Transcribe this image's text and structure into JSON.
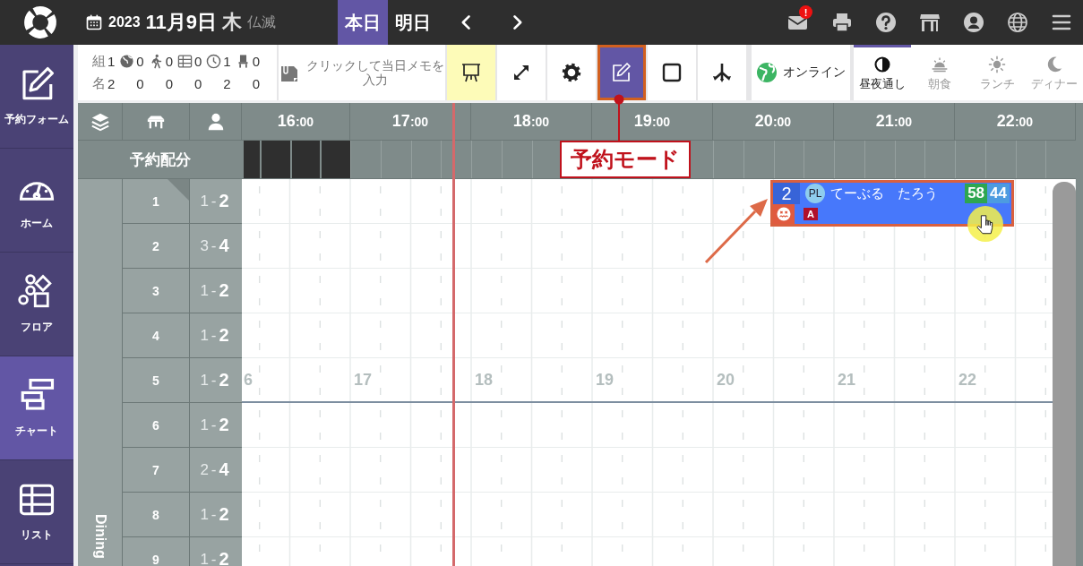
{
  "top_bar": {
    "date": {
      "year": "2023",
      "day": "11月9日",
      "weekday": "木",
      "rokuyo": "仏滅"
    },
    "day_tabs": [
      {
        "label": "本日",
        "selected": true
      },
      {
        "label": "明日",
        "selected": false
      }
    ],
    "mail_badge": "!"
  },
  "sidebar": {
    "items": [
      {
        "kind": "form",
        "label": "予約フォーム",
        "selected": false
      },
      {
        "kind": "home",
        "label": "ホーム",
        "selected": false
      },
      {
        "kind": "floor",
        "label": "フロア",
        "selected": false
      },
      {
        "kind": "chart",
        "label": "チャート",
        "selected": true
      },
      {
        "kind": "list",
        "label": "リスト",
        "selected": false
      }
    ]
  },
  "toolbar": {
    "stats": {
      "row_labels": [
        "組",
        "名"
      ],
      "columns": [
        {
          "kind": "total",
          "values": [
            "1",
            "2"
          ]
        },
        {
          "kind": "web",
          "values": [
            "0",
            "0"
          ]
        },
        {
          "kind": "walk_in",
          "values": [
            "0",
            "0"
          ]
        },
        {
          "kind": "list",
          "values": [
            "0",
            "0"
          ]
        },
        {
          "kind": "waiting",
          "values": [
            "1",
            "2"
          ]
        },
        {
          "kind": "seated",
          "values": [
            "0",
            "0"
          ]
        }
      ]
    },
    "memo": "クリックして当日メモを入力",
    "tools": [
      {
        "kind": "easel",
        "on": true,
        "highlighted": false
      },
      {
        "kind": "expand",
        "on": false,
        "highlighted": false
      },
      {
        "kind": "gear",
        "on": false,
        "highlighted": false
      },
      {
        "kind": "edit",
        "on": true,
        "highlighted": true
      },
      {
        "kind": "square",
        "on": false,
        "highlighted": false
      },
      {
        "kind": "fork",
        "on": false,
        "highlighted": false
      }
    ],
    "online": "オンライン",
    "meal_tabs": [
      {
        "kind": "all",
        "label": "昼夜通し",
        "selected": true
      },
      {
        "kind": "breakfast",
        "label": "朝食",
        "selected": false
      },
      {
        "kind": "lunch",
        "label": "ランチ",
        "selected": false
      },
      {
        "kind": "dinner",
        "label": "ディナー",
        "selected": false
      }
    ]
  },
  "chart": {
    "times": [
      {
        "label": "**16**:00",
        "blocked": true
      },
      {
        "label": "**17**:00",
        "blocked": false
      },
      {
        "label": "**18**:00",
        "blocked": false
      },
      {
        "label": "**19**:00",
        "blocked": false
      },
      {
        "label": "**20**:00",
        "blocked": false
      },
      {
        "label": "**21**:00",
        "blocked": false
      },
      {
        "label": "**22**:00",
        "blocked": false
      }
    ],
    "allocation_label": "予約配分",
    "area": "Dining",
    "hour_marks": [
      "6",
      "17",
      "18",
      "19",
      "20",
      "21",
      "22"
    ],
    "tables": [
      {
        "number": "1",
        "capacity": "1-**2**",
        "corner_mark": true,
        "hour_marks": false
      },
      {
        "number": "2",
        "capacity": "3-**4**",
        "corner_mark": false,
        "hour_marks": false
      },
      {
        "number": "3",
        "capacity": "1-**2**",
        "corner_mark": false,
        "hour_marks": false
      },
      {
        "number": "4",
        "capacity": "1-**2**",
        "corner_mark": false,
        "hour_marks": false
      },
      {
        "number": "5",
        "capacity": "1-**2**",
        "corner_mark": false,
        "hour_marks": true
      },
      {
        "number": "6",
        "capacity": "1-**2**",
        "corner_mark": false,
        "hour_marks": false
      },
      {
        "number": "7",
        "capacity": "2-**4**",
        "corner_mark": false,
        "hour_marks": false
      },
      {
        "number": "8",
        "capacity": "1-**2**",
        "corner_mark": false,
        "hour_marks": false
      },
      {
        "number": "9",
        "capacity": "1-**2**",
        "corner_mark": false,
        "hour_marks": false
      }
    ],
    "reservation": {
      "party": "2",
      "staff": "PL",
      "name": "てーぶる　たろう",
      "count_a": "58",
      "count_b": "44",
      "tag": "A"
    }
  },
  "callout": "予約モード"
}
